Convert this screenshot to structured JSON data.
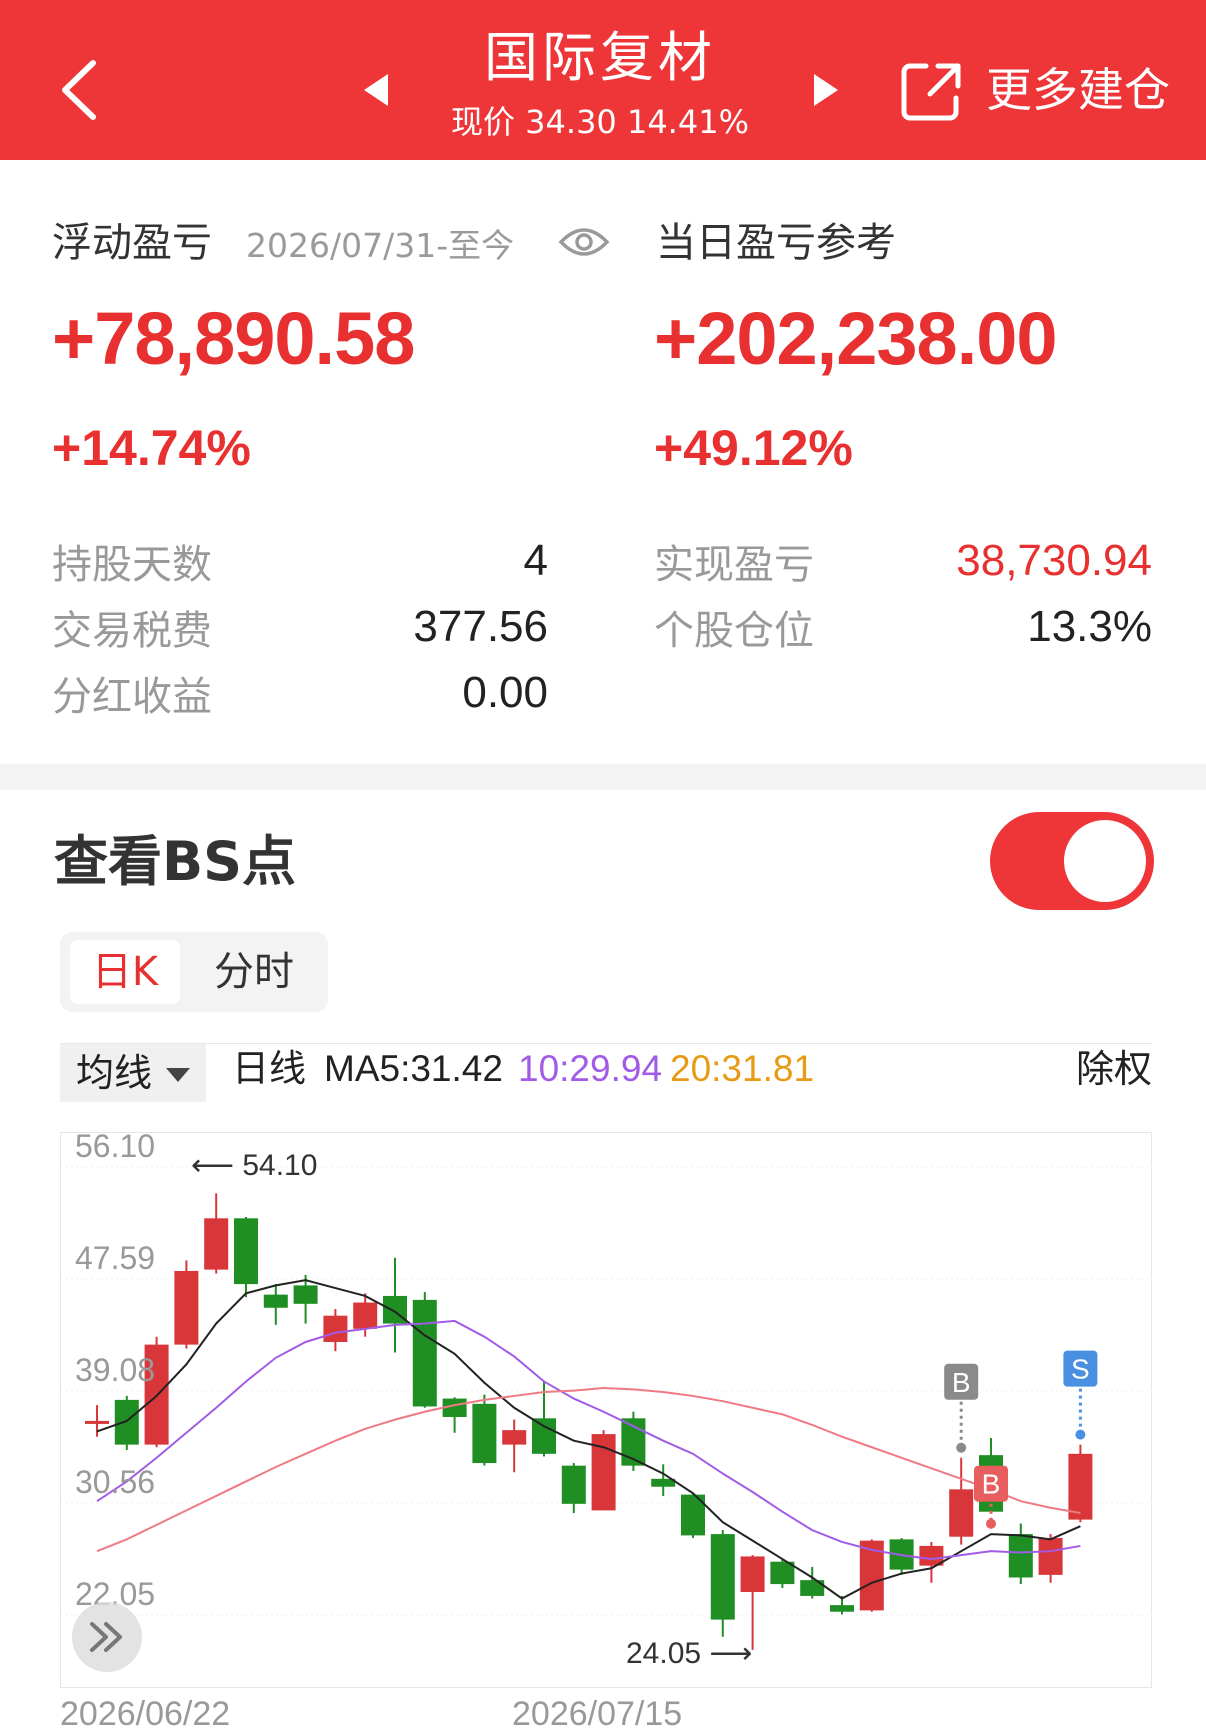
{
  "header": {
    "title": "国际复材",
    "subtitle": "现价 34.30 14.41%",
    "more_label": "更多建仓"
  },
  "summary": {
    "floating_label": "浮动盈亏",
    "date_range": "2026/07/31-至今",
    "floating_value": "+78,890.58",
    "floating_pct": "+14.74%",
    "daily_label": "当日盈亏参考",
    "daily_value": "+202,238.00",
    "daily_pct": "+49.12%"
  },
  "stats": {
    "left": [
      {
        "label": "持股天数",
        "value": "4"
      },
      {
        "label": "交易税费",
        "value": "377.56"
      },
      {
        "label": "分红收益",
        "value": "0.00"
      }
    ],
    "right": [
      {
        "label": "实现盈亏",
        "value": "38,730.94"
      },
      {
        "label": "个股仓位",
        "value": "13.3%"
      }
    ]
  },
  "bs_section": {
    "title": "查看BS点",
    "toggle_on": true,
    "tabs": [
      {
        "label": "日K",
        "active": true
      },
      {
        "label": "分时",
        "active": false
      }
    ]
  },
  "ma_bar": {
    "dropdown_label": "均线",
    "line_type": "日线",
    "ma5": "MA5:31.42",
    "ma10": "10:29.94",
    "ma20": "20:31.81",
    "adjust": "除权",
    "colors": {
      "ma5": "#222222",
      "ma10": "#a15be6",
      "ma20": "#e89a14"
    }
  },
  "colors": {
    "up": "#d9363a",
    "down": "#1f8f24",
    "accent": "#ee3538"
  },
  "chart_data": {
    "type": "candlestick",
    "y_ticks": [
      "56.10",
      "47.59",
      "39.08",
      "30.56",
      "22.05"
    ],
    "ylim": [
      22.05,
      56.1
    ],
    "x_labels": [
      "2026/06/22",
      "2026/07/15"
    ],
    "high_marker": "54.10",
    "low_marker": "24.05",
    "candles": [
      {
        "o": 36.8,
        "c": 36.8,
        "h": 38.0,
        "l": 35.6
      },
      {
        "o": 38.4,
        "c": 35.0,
        "h": 38.7,
        "l": 34.6
      },
      {
        "o": 35.0,
        "c": 42.6,
        "h": 43.2,
        "l": 34.8
      },
      {
        "o": 42.6,
        "c": 48.2,
        "h": 49.0,
        "l": 42.3
      },
      {
        "o": 48.3,
        "c": 52.2,
        "h": 54.1,
        "l": 48.0
      },
      {
        "o": 52.2,
        "c": 47.2,
        "h": 52.3,
        "l": 46.2
      },
      {
        "o": 46.4,
        "c": 45.4,
        "h": 47.2,
        "l": 44.1
      },
      {
        "o": 47.1,
        "c": 45.7,
        "h": 47.9,
        "l": 44.2
      },
      {
        "o": 42.8,
        "c": 44.8,
        "h": 45.3,
        "l": 42.1
      },
      {
        "o": 43.8,
        "c": 45.8,
        "h": 46.5,
        "l": 43.2
      },
      {
        "o": 46.3,
        "c": 44.2,
        "h": 49.2,
        "l": 42.0
      },
      {
        "o": 46.0,
        "c": 37.9,
        "h": 46.6,
        "l": 37.8
      },
      {
        "o": 38.5,
        "c": 37.1,
        "h": 38.6,
        "l": 35.9
      },
      {
        "o": 38.1,
        "c": 33.6,
        "h": 38.8,
        "l": 33.4
      },
      {
        "o": 35.0,
        "c": 36.1,
        "h": 36.9,
        "l": 32.9
      },
      {
        "o": 37.0,
        "c": 34.3,
        "h": 39.8,
        "l": 34.1
      },
      {
        "o": 33.4,
        "c": 30.5,
        "h": 33.6,
        "l": 29.8
      },
      {
        "o": 30.0,
        "c": 35.8,
        "h": 36.1,
        "l": 30.0
      },
      {
        "o": 37.0,
        "c": 33.4,
        "h": 37.5,
        "l": 33.0
      },
      {
        "o": 32.4,
        "c": 31.8,
        "h": 33.5,
        "l": 31.1
      },
      {
        "o": 31.2,
        "c": 28.1,
        "h": 31.3,
        "l": 27.9
      },
      {
        "o": 28.2,
        "c": 21.7,
        "h": 28.5,
        "l": 20.4
      },
      {
        "o": 23.8,
        "c": 26.5,
        "h": 26.6,
        "l": 19.4
      },
      {
        "o": 26.1,
        "c": 24.4,
        "h": 26.3,
        "l": 24.1
      },
      {
        "o": 24.7,
        "c": 23.5,
        "h": 25.7,
        "l": 23.3
      },
      {
        "o": 22.8,
        "c": 22.3,
        "h": 23.5,
        "l": 22.1
      },
      {
        "o": 22.4,
        "c": 27.7,
        "h": 27.8,
        "l": 22.3
      },
      {
        "o": 27.8,
        "c": 25.5,
        "h": 27.9,
        "l": 25.1
      },
      {
        "o": 25.8,
        "c": 27.3,
        "h": 27.6,
        "l": 24.5
      },
      {
        "o": 28.0,
        "c": 31.6,
        "h": 34.0,
        "l": 27.4
      },
      {
        "o": 34.2,
        "c": 29.9,
        "h": 35.5,
        "l": 29.8
      },
      {
        "o": 28.2,
        "c": 24.9,
        "h": 29.0,
        "l": 24.4
      },
      {
        "o": 25.1,
        "c": 27.9,
        "h": 28.2,
        "l": 24.5
      },
      {
        "o": 29.3,
        "c": 34.3,
        "h": 35.0,
        "l": 29.1
      }
    ],
    "series": [
      {
        "name": "MA5",
        "color": "#222222",
        "values": [
          36.0,
          36.8,
          38.7,
          41.1,
          44.2,
          46.5,
          47.1,
          47.5,
          46.9,
          46.3,
          45.1,
          43.3,
          41.9,
          39.7,
          37.8,
          36.4,
          35.3,
          34.8,
          33.9,
          32.8,
          31.3,
          29.1,
          27.7,
          26.3,
          24.9,
          23.3,
          24.5,
          25.2,
          25.6,
          26.9,
          28.2,
          28.1,
          27.8,
          28.8
        ]
      },
      {
        "name": "MA10",
        "color": "#a15be6",
        "values": [
          30.7,
          32.2,
          34.0,
          35.9,
          37.8,
          39.8,
          41.6,
          42.8,
          43.5,
          43.8,
          44.1,
          44.2,
          44.4,
          43.2,
          41.7,
          39.8,
          38.5,
          37.5,
          36.4,
          35.3,
          34.3,
          32.8,
          31.4,
          29.9,
          28.5,
          27.6,
          27.0,
          26.6,
          26.3,
          26.6,
          26.9,
          26.8,
          26.9,
          27.3
        ]
      },
      {
        "name": "MA20",
        "color": "#ef7a85",
        "values": [
          26.9,
          27.8,
          28.9,
          30.0,
          31.1,
          32.2,
          33.3,
          34.3,
          35.3,
          36.2,
          36.9,
          37.5,
          38.0,
          38.4,
          38.7,
          39.0,
          39.1,
          39.3,
          39.2,
          39.0,
          38.7,
          38.3,
          37.8,
          37.3,
          36.5,
          35.6,
          34.8,
          34.0,
          33.2,
          32.4,
          31.6,
          30.7,
          30.2,
          29.8
        ]
      }
    ],
    "bs_markers": [
      {
        "label": "B",
        "index": 29,
        "color": "#8a8a8a",
        "position": "above-high"
      },
      {
        "label": "B",
        "index": 30,
        "color": "#e85d5d",
        "position": "below-close"
      },
      {
        "label": "S",
        "index": 33,
        "color": "#4a90e2",
        "position": "above-high"
      }
    ]
  }
}
